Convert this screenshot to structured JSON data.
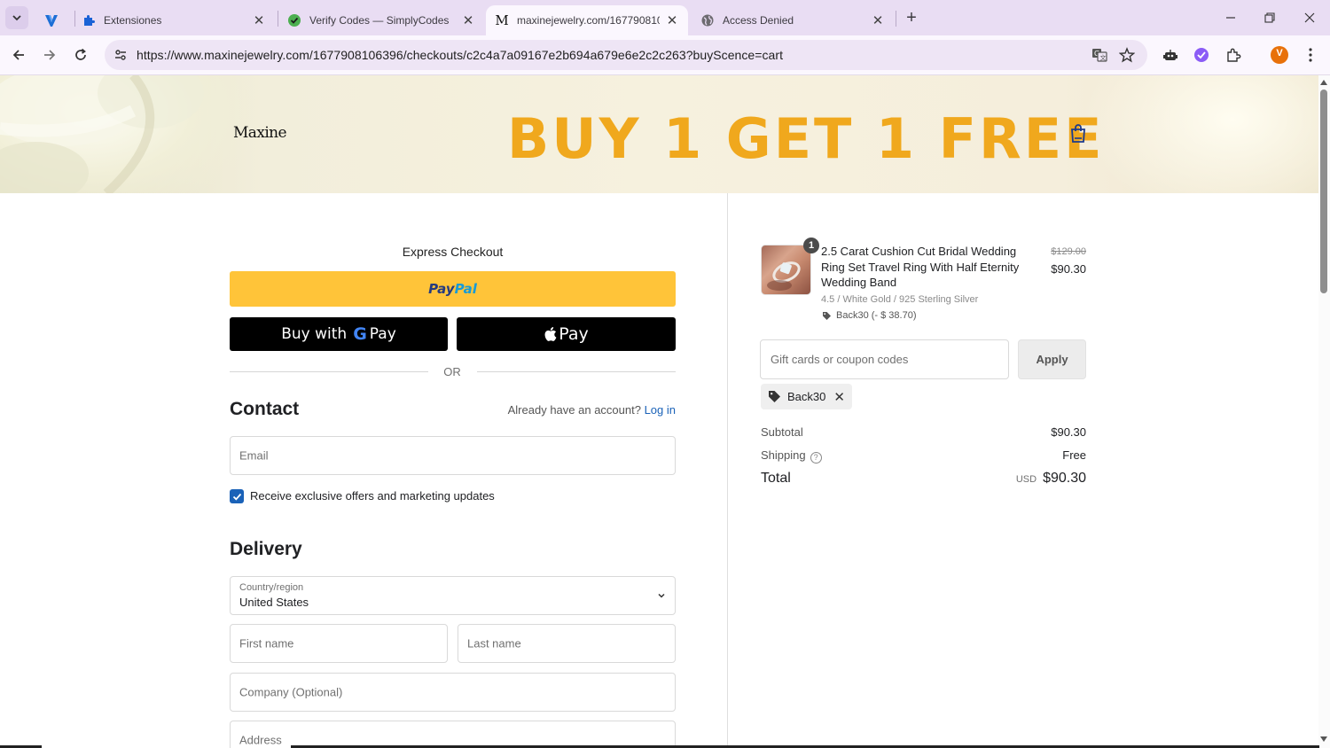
{
  "browser": {
    "tabs": [
      {
        "title": ""
      },
      {
        "title": "Extensiones"
      },
      {
        "title": "Verify Codes — SimplyCodes"
      },
      {
        "title": "maxinejewelry.com/167790810"
      },
      {
        "title": "Access Denied"
      }
    ],
    "url": "https://www.maxinejewelry.com/1677908106396/checkouts/c2c4a7a09167e2b694a679e6e2c2c263?buyScence=cart",
    "profile_initial": "V"
  },
  "header": {
    "brand": "Maxine",
    "promo": "BUY 1 GET 1 FREE"
  },
  "checkout": {
    "express_title": "Express Checkout",
    "paypal_pay": "Pay",
    "paypal_pal": "Pal",
    "gpay_prefix": "Buy with",
    "gpay_g": "G",
    "gpay_suffix": "Pay",
    "apple_pay": "Pay",
    "or": "OR",
    "contact_title": "Contact",
    "account_prompt": "Already have an account?",
    "login_link": "Log in",
    "email_placeholder": "Email",
    "marketing_label": "Receive exclusive offers and marketing updates",
    "marketing_checked": true,
    "delivery_title": "Delivery",
    "country_label": "Country/region",
    "country_value": "United States",
    "first_name_placeholder": "First name",
    "last_name_placeholder": "Last name",
    "company_placeholder": "Company (Optional)",
    "address_placeholder": "Address"
  },
  "summary": {
    "item": {
      "quantity": "1",
      "title": "2.5 Carat Cushion Cut Bridal Wedding Ring Set Travel Ring With Half Eternity Wedding Band",
      "original_price": "$129.00",
      "price": "$90.30",
      "variant": "4.5 / White Gold / 925 Sterling Silver",
      "discount": "Back30 (- $ 38.70)"
    },
    "coupon_placeholder": "Gift cards or coupon codes",
    "apply_label": "Apply",
    "applied_code": "Back30",
    "subtotal_label": "Subtotal",
    "subtotal_value": "$90.30",
    "shipping_label": "Shipping",
    "shipping_value": "Free",
    "total_label": "Total",
    "total_currency": "USD",
    "total_value": "$90.30"
  },
  "colors": {
    "paypal_yellow": "#ffc439",
    "promo_gold": "#f0a81d",
    "link_blue": "#1a62b8",
    "tabstrip": "#e9ddf3"
  }
}
